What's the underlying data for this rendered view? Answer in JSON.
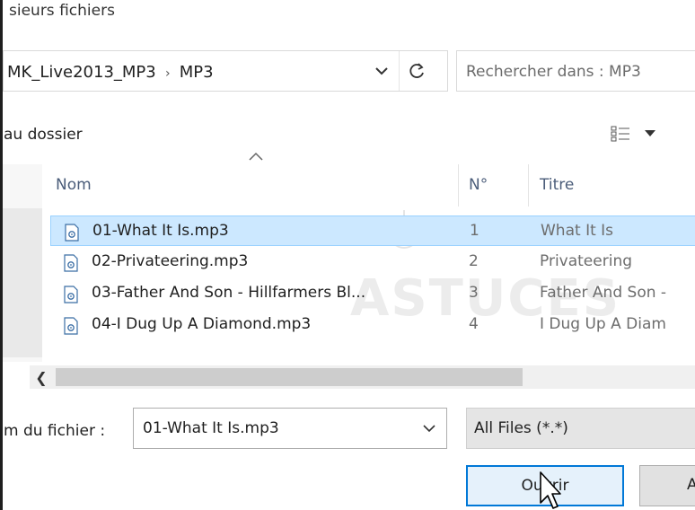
{
  "dialog": {
    "title_partial": "sieurs fichiers"
  },
  "address_bar": {
    "crumbs": [
      "MK_Live2013_MP3",
      "MP3"
    ],
    "separator": "›",
    "dropdown_icon": "chevron-down-icon",
    "refresh_icon": "refresh-icon"
  },
  "search": {
    "placeholder": "Rechercher dans : MP3"
  },
  "toolbar": {
    "new_folder_partial": "au dossier",
    "view_icon": "view-options-icon"
  },
  "columns": {
    "name": "Nom",
    "number": "N°",
    "title": "Titre"
  },
  "files": [
    {
      "name": "01-What It Is.mp3",
      "number": "1",
      "title": "What It Is",
      "selected": true
    },
    {
      "name": "02-Privateering.mp3",
      "number": "2",
      "title": "Privateering",
      "selected": false
    },
    {
      "name": "03-Father And Son - Hillfarmers Bl...",
      "number": "3",
      "title": "Father And Son -",
      "selected": false
    },
    {
      "name": "04-I Dug Up A Diamond.mp3",
      "number": "4",
      "title": "I Dug Up A Diam",
      "selected": false
    }
  ],
  "watermark": "ASTUCES",
  "filename": {
    "label_partial": "m du fichier :",
    "value": "01-What It Is.mp3"
  },
  "filter": {
    "value": "All Files (*.*)"
  },
  "buttons": {
    "open": "Ouvrir",
    "cancel_partial": "A"
  },
  "colors": {
    "accent": "#0078d7",
    "selection": "#cce8ff",
    "header_text": "#4b5d7a"
  }
}
